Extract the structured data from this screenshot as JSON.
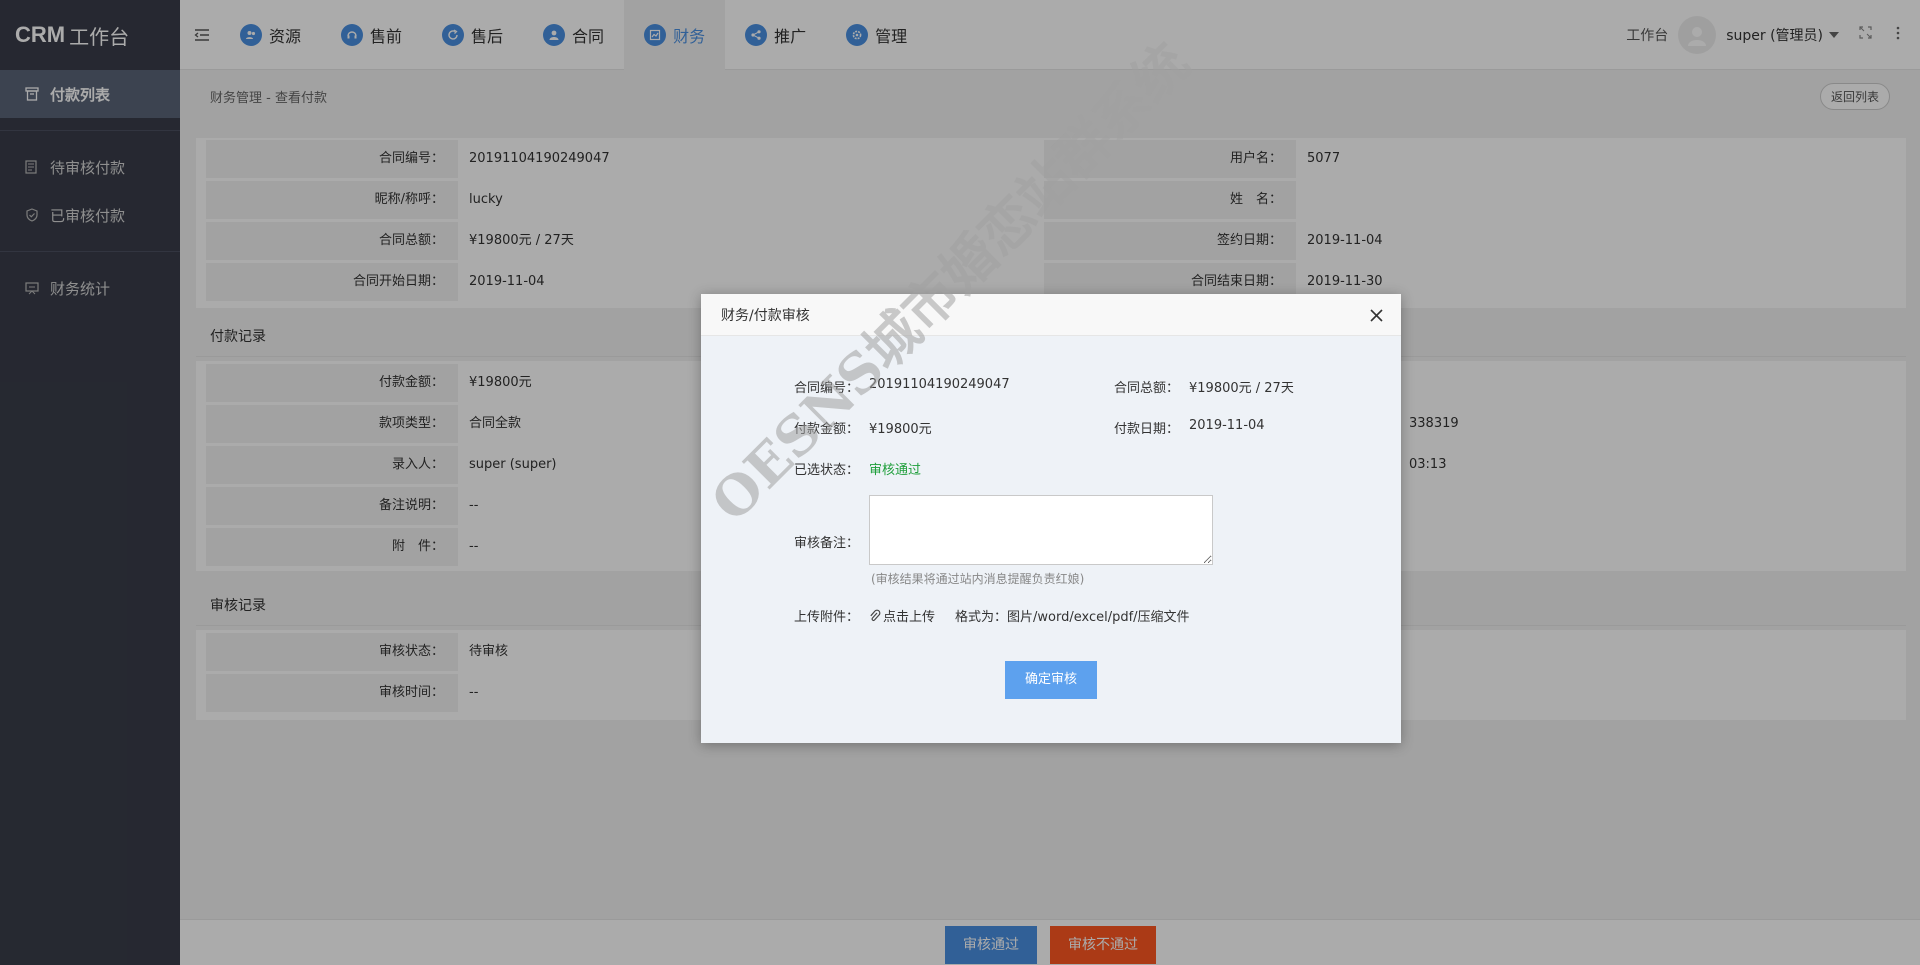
{
  "brand": {
    "name": "CRM",
    "suffix": "工作台"
  },
  "sidebar": {
    "items": [
      {
        "label": "付款列表",
        "active": true,
        "icon": "trash-box-icon"
      },
      {
        "label": "待审核付款",
        "active": false,
        "icon": "document-list-icon"
      },
      {
        "label": "已审核付款",
        "active": false,
        "icon": "shield-check-icon"
      },
      {
        "label": "财务统计",
        "active": false,
        "icon": "presentation-chart-icon"
      }
    ]
  },
  "topbar": {
    "nav": [
      {
        "label": "资源",
        "icon": "users-icon"
      },
      {
        "label": "售前",
        "icon": "headset-icon"
      },
      {
        "label": "售后",
        "icon": "refresh-icon"
      },
      {
        "label": "合同",
        "icon": "user-icon"
      },
      {
        "label": "财务",
        "icon": "chart-line-icon",
        "active": true
      },
      {
        "label": "推广",
        "icon": "share-icon"
      },
      {
        "label": "管理",
        "icon": "gear-icon"
      }
    ],
    "workbench": "工作台",
    "user": "super (管理员)"
  },
  "page": {
    "breadcrumb": "财务管理 - 查看付款",
    "back_label": "返回列表",
    "contract": {
      "left": [
        {
          "label": "合同编号：",
          "value": "20191104190249047"
        },
        {
          "label": "昵称/称呼：",
          "value": "lucky"
        },
        {
          "label": "合同总额：",
          "value": "¥19800元 / 27天"
        },
        {
          "label": "合同开始日期：",
          "value": "2019-11-04"
        }
      ],
      "right": [
        {
          "label": "用户名：",
          "value": "5077"
        },
        {
          "label": "姓　名：",
          "value": ""
        },
        {
          "label": "签约日期：",
          "value": "2019-11-04"
        },
        {
          "label": "合同结束日期：",
          "value": "2019-11-30"
        }
      ]
    },
    "payment_title": "付款记录",
    "payment": [
      {
        "label": "付款金额：",
        "value": "¥19800元"
      },
      {
        "label": "款项类型：",
        "value": "合同全款"
      },
      {
        "label": "录入人：",
        "value": "super (super)"
      },
      {
        "label": "备注说明：",
        "value": "--"
      },
      {
        "label": "附　件：",
        "value": "--"
      }
    ],
    "payment_right_partial": [
      "338319",
      "03:13"
    ],
    "audit_title": "审核记录",
    "audit": [
      {
        "label": "审核状态：",
        "value": "待审核"
      },
      {
        "label": "审核时间：",
        "value": "--"
      }
    ]
  },
  "bottom": {
    "approve": "审核通过",
    "reject": "审核不通过"
  },
  "modal": {
    "title": "财务/付款审核",
    "contract_no_label": "合同编号：",
    "contract_no": "20191104190249047",
    "total_label": "合同总额：",
    "total": "¥19800元 / 27天",
    "amount_label": "付款金额：",
    "amount": "¥19800元",
    "date_label": "付款日期：",
    "date": "2019-11-04",
    "status_label": "已选状态：",
    "status": "审核通过",
    "note_label": "审核备注：",
    "note_hint": "(审核结果将通过站内消息提醒负责红娘)",
    "upload_label": "上传附件：",
    "upload_action": "点击上传",
    "format": "格式为：图片/word/excel/pdf/压缩文件",
    "confirm": "确定审核"
  },
  "watermark": "OESNS城市婚恋站群系统",
  "colors": {
    "primary": "#4a90e2",
    "danger": "#ff5722",
    "sidebar": "#393d49",
    "status_green": "#1e9e3a"
  }
}
